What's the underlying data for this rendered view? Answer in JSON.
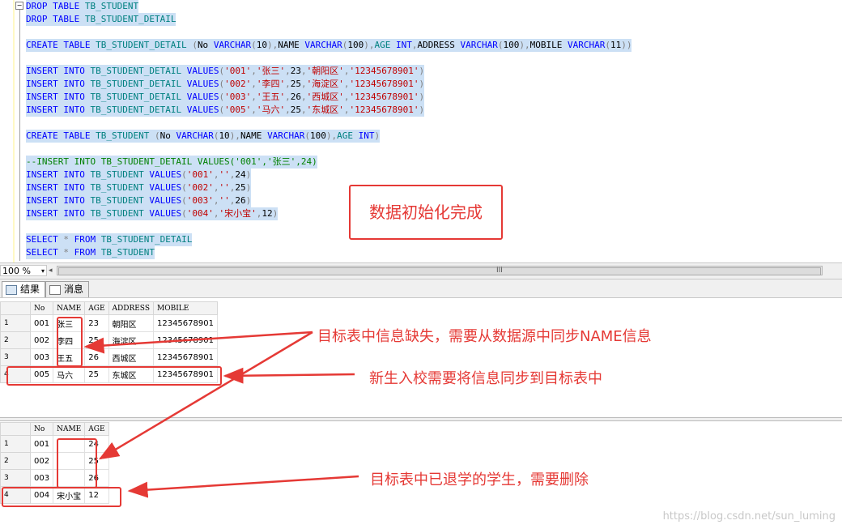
{
  "editor": {
    "lines": [
      [
        [
          "kw",
          "DROP TABLE "
        ],
        [
          "id",
          "TB_STUDENT"
        ]
      ],
      [
        [
          "kw",
          "DROP TABLE "
        ],
        [
          "id",
          "TB_STUDENT_DETAIL"
        ]
      ],
      [],
      [
        [
          "kw",
          "CREATE TABLE "
        ],
        [
          "id",
          "TB_STUDENT_DETAIL "
        ],
        [
          "gray",
          "("
        ],
        [
          "plain",
          "No "
        ],
        [
          "kw",
          "VARCHAR"
        ],
        [
          "gray",
          "("
        ],
        [
          "plain",
          "10"
        ],
        [
          "gray",
          "),"
        ],
        [
          "plain",
          "NAME "
        ],
        [
          "kw",
          "VARCHAR"
        ],
        [
          "gray",
          "("
        ],
        [
          "plain",
          "100"
        ],
        [
          "gray",
          "),"
        ],
        [
          "id",
          "AGE "
        ],
        [
          "kw",
          "INT"
        ],
        [
          "gray",
          ","
        ],
        [
          "plain",
          "ADDRESS "
        ],
        [
          "kw",
          "VARCHAR"
        ],
        [
          "gray",
          "("
        ],
        [
          "plain",
          "100"
        ],
        [
          "gray",
          "),"
        ],
        [
          "plain",
          "MOBILE "
        ],
        [
          "kw",
          "VARCHAR"
        ],
        [
          "gray",
          "("
        ],
        [
          "plain",
          "11"
        ],
        [
          "gray",
          "))"
        ]
      ],
      [],
      [
        [
          "kw",
          "INSERT INTO "
        ],
        [
          "id",
          "TB_STUDENT_DETAIL "
        ],
        [
          "kw",
          "VALUES"
        ],
        [
          "gray",
          "("
        ],
        [
          "str",
          "'001'"
        ],
        [
          "gray",
          ","
        ],
        [
          "str",
          "'张三'"
        ],
        [
          "gray",
          ","
        ],
        [
          "plain",
          "23"
        ],
        [
          "gray",
          ","
        ],
        [
          "str",
          "'朝阳区'"
        ],
        [
          "gray",
          ","
        ],
        [
          "str",
          "'12345678901'"
        ],
        [
          "gray",
          ")"
        ]
      ],
      [
        [
          "kw",
          "INSERT INTO "
        ],
        [
          "id",
          "TB_STUDENT_DETAIL "
        ],
        [
          "kw",
          "VALUES"
        ],
        [
          "gray",
          "("
        ],
        [
          "str",
          "'002'"
        ],
        [
          "gray",
          ","
        ],
        [
          "str",
          "'李四'"
        ],
        [
          "gray",
          ","
        ],
        [
          "plain",
          "25"
        ],
        [
          "gray",
          ","
        ],
        [
          "str",
          "'海淀区'"
        ],
        [
          "gray",
          ","
        ],
        [
          "str",
          "'12345678901'"
        ],
        [
          "gray",
          ")"
        ]
      ],
      [
        [
          "kw",
          "INSERT INTO "
        ],
        [
          "id",
          "TB_STUDENT_DETAIL "
        ],
        [
          "kw",
          "VALUES"
        ],
        [
          "gray",
          "("
        ],
        [
          "str",
          "'003'"
        ],
        [
          "gray",
          ","
        ],
        [
          "str",
          "'王五'"
        ],
        [
          "gray",
          ","
        ],
        [
          "plain",
          "26"
        ],
        [
          "gray",
          ","
        ],
        [
          "str",
          "'西城区'"
        ],
        [
          "gray",
          ","
        ],
        [
          "str",
          "'12345678901'"
        ],
        [
          "gray",
          ")"
        ]
      ],
      [
        [
          "kw",
          "INSERT INTO "
        ],
        [
          "id",
          "TB_STUDENT_DETAIL "
        ],
        [
          "kw",
          "VALUES"
        ],
        [
          "gray",
          "("
        ],
        [
          "str",
          "'005'"
        ],
        [
          "gray",
          ","
        ],
        [
          "str",
          "'马六'"
        ],
        [
          "gray",
          ","
        ],
        [
          "plain",
          "25"
        ],
        [
          "gray",
          ","
        ],
        [
          "str",
          "'东城区'"
        ],
        [
          "gray",
          ","
        ],
        [
          "str",
          "'12345678901'"
        ],
        [
          "gray",
          ")"
        ]
      ],
      [],
      [
        [
          "kw",
          "CREATE TABLE "
        ],
        [
          "id",
          "TB_STUDENT "
        ],
        [
          "gray",
          "("
        ],
        [
          "plain",
          "No "
        ],
        [
          "kw",
          "VARCHAR"
        ],
        [
          "gray",
          "("
        ],
        [
          "plain",
          "10"
        ],
        [
          "gray",
          "),"
        ],
        [
          "plain",
          "NAME "
        ],
        [
          "kw",
          "VARCHAR"
        ],
        [
          "gray",
          "("
        ],
        [
          "plain",
          "100"
        ],
        [
          "gray",
          "),"
        ],
        [
          "id",
          "AGE "
        ],
        [
          "kw",
          "INT"
        ],
        [
          "gray",
          ")"
        ]
      ],
      [],
      [
        [
          "cmt",
          "--INSERT INTO TB_STUDENT_DETAIL VALUES('001','张三',24)"
        ]
      ],
      [
        [
          "kw",
          "INSERT INTO "
        ],
        [
          "id",
          "TB_STUDENT "
        ],
        [
          "kw",
          "VALUES"
        ],
        [
          "gray",
          "("
        ],
        [
          "str",
          "'001'"
        ],
        [
          "gray",
          ","
        ],
        [
          "str",
          "''"
        ],
        [
          "gray",
          ","
        ],
        [
          "plain",
          "24"
        ],
        [
          "gray",
          ")"
        ]
      ],
      [
        [
          "kw",
          "INSERT INTO "
        ],
        [
          "id",
          "TB_STUDENT "
        ],
        [
          "kw",
          "VALUES"
        ],
        [
          "gray",
          "("
        ],
        [
          "str",
          "'002'"
        ],
        [
          "gray",
          ","
        ],
        [
          "str",
          "''"
        ],
        [
          "gray",
          ","
        ],
        [
          "plain",
          "25"
        ],
        [
          "gray",
          ")"
        ]
      ],
      [
        [
          "kw",
          "INSERT INTO "
        ],
        [
          "id",
          "TB_STUDENT "
        ],
        [
          "kw",
          "VALUES"
        ],
        [
          "gray",
          "("
        ],
        [
          "str",
          "'003'"
        ],
        [
          "gray",
          ","
        ],
        [
          "str",
          "''"
        ],
        [
          "gray",
          ","
        ],
        [
          "plain",
          "26"
        ],
        [
          "gray",
          ")"
        ]
      ],
      [
        [
          "kw",
          "INSERT INTO "
        ],
        [
          "id",
          "TB_STUDENT "
        ],
        [
          "kw",
          "VALUES"
        ],
        [
          "gray",
          "("
        ],
        [
          "str",
          "'004'"
        ],
        [
          "gray",
          ","
        ],
        [
          "str",
          "'宋小宝'"
        ],
        [
          "gray",
          ","
        ],
        [
          "plain",
          "12"
        ],
        [
          "gray",
          ")"
        ]
      ],
      [],
      [
        [
          "kw",
          "SELECT "
        ],
        [
          "gray",
          "* "
        ],
        [
          "kw",
          "FROM "
        ],
        [
          "id",
          "TB_STUDENT_DETAIL"
        ]
      ],
      [
        [
          "kw",
          "SELECT "
        ],
        [
          "gray",
          "* "
        ],
        [
          "kw",
          "FROM "
        ],
        [
          "id",
          "TB_STUDENT"
        ]
      ]
    ]
  },
  "statusbar": {
    "zoom": "100 %",
    "zoom_arrow": "▾",
    "scroll_left": "◂",
    "grip": "III"
  },
  "tabs": {
    "results": "结果",
    "messages": "消息"
  },
  "grid1": {
    "headers": [
      "No",
      "NAME",
      "AGE",
      "ADDRESS",
      "MOBILE"
    ],
    "rows": [
      [
        "1",
        "001",
        "张三",
        "23",
        "朝阳区",
        "12345678901"
      ],
      [
        "2",
        "002",
        "李四",
        "25",
        "海淀区",
        "12345678901"
      ],
      [
        "3",
        "003",
        "王五",
        "26",
        "西城区",
        "12345678901"
      ],
      [
        "4",
        "005",
        "马六",
        "25",
        "东城区",
        "12345678901"
      ]
    ]
  },
  "grid2": {
    "headers": [
      "No",
      "NAME",
      "AGE"
    ],
    "rows": [
      [
        "1",
        "001",
        "",
        "24"
      ],
      [
        "2",
        "002",
        "",
        "25"
      ],
      [
        "3",
        "003",
        "",
        "26"
      ],
      [
        "4",
        "004",
        "宋小宝",
        "12"
      ]
    ]
  },
  "annotations": {
    "callout": "数据初始化完成",
    "missing_info": "目标表中信息缺失，需要从数据源中同步NAME信息",
    "new_student": "新生入校需要将信息同步到目标表中",
    "withdrawn": "目标表中已退学的学生，需要删除",
    "accent_color": "#e53935"
  },
  "watermark": "https://blog.csdn.net/sun_luming"
}
